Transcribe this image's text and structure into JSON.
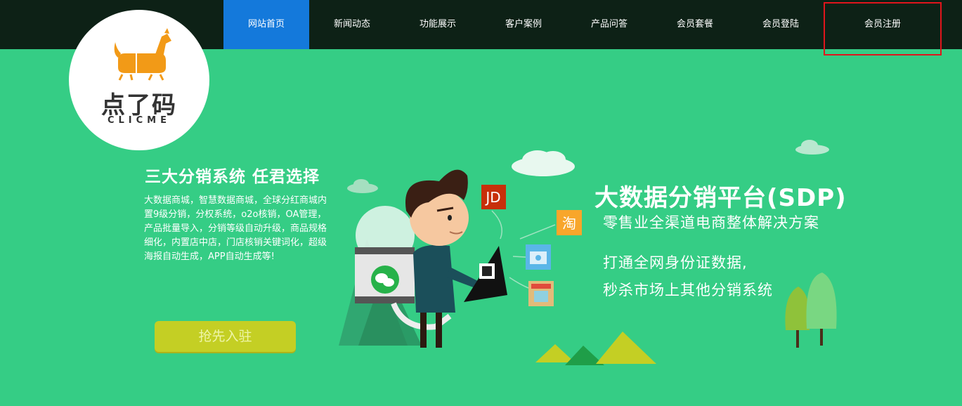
{
  "nav": {
    "items": [
      {
        "label": "网站首页",
        "active": true
      },
      {
        "label": "新闻动态"
      },
      {
        "label": "功能展示"
      },
      {
        "label": "客户案例"
      },
      {
        "label": "产品问答"
      },
      {
        "label": "会员套餐"
      },
      {
        "label": "会员登陆"
      },
      {
        "label": "会员注册",
        "highlighted": true
      }
    ]
  },
  "logo": {
    "cn": "点了码",
    "en": "CLICME"
  },
  "hero": {
    "left_title": "三大分销系统 任君选择",
    "left_desc": "大数据商城，智慧数据商城，全球分红商城内置9级分销，分权系统，o2o核销，OA管理，产品批量导入，分销等级自动升级，商品规格细化，内置店中店，门店核销关键词化，超级海报自动生成，APP自动生成等!",
    "cta": "抢先入驻",
    "right_title": "大数据分销平台(SDP)",
    "right_sub": "零售业全渠道电商整体解决方案",
    "right_p1": "打通全网身份证数据,",
    "right_p2": "秒杀市场上其他分销系统",
    "jd_label": "JD",
    "taobao_label": "淘"
  },
  "colors": {
    "background": "#35cd85",
    "nav_bg": "#0d2116",
    "nav_active": "#1479db",
    "highlight_border": "#e0151c",
    "cta_bg": "#c4cf24"
  }
}
